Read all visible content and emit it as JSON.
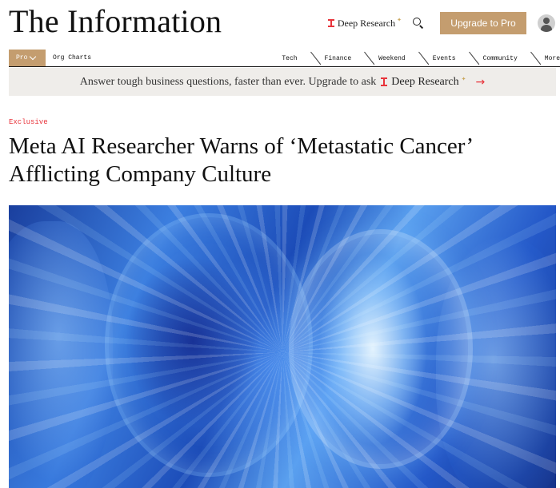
{
  "header": {
    "brand": "The Information",
    "deep_research_label": "Deep Research",
    "upgrade_label": "Upgrade to Pro",
    "accent_color": "#c49d6f",
    "brand_red": "#e8343b"
  },
  "nav": {
    "pro_label": "Pro",
    "org_charts_label": "Org Charts",
    "items": [
      {
        "label": "Tech"
      },
      {
        "label": "Finance"
      },
      {
        "label": "Weekend"
      },
      {
        "label": "Events"
      },
      {
        "label": "Community"
      },
      {
        "label": "More"
      }
    ]
  },
  "promo": {
    "text": "Answer tough business questions, faster than ever. Upgrade to ask",
    "deep_research_label": "Deep Research",
    "arrow_icon": "arrow-right-icon"
  },
  "article": {
    "kicker": "Exclusive",
    "headline": "Meta AI Researcher Warns of ‘Metastatic Cancer’ Afflicting Company Culture"
  },
  "icons": {
    "search": "search-icon",
    "avatar": "user-avatar-icon",
    "chevron": "chevron-down-icon",
    "deep_research": "deep-research-logo-icon"
  }
}
